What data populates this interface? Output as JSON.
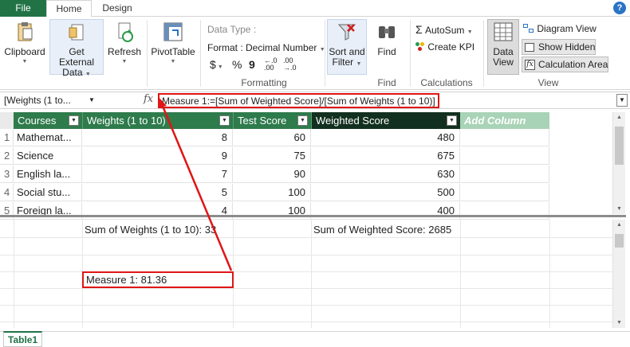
{
  "tabs": {
    "file": "File",
    "home": "Home",
    "design": "Design",
    "help": "?"
  },
  "ribbon": {
    "clipboard": "Clipboard",
    "get_external_data_line1": "Get External",
    "get_external_data_line2": "Data",
    "refresh": "Refresh",
    "pivottable": "PivotTable",
    "data_type": "Data Type :",
    "format": "Format : Decimal Number",
    "currency_symbol": "$",
    "percent_symbol": "%",
    "comma_symbol": "9",
    "formatting_group": "Formatting",
    "sort_filter_line1": "Sort and",
    "sort_filter_line2": "Filter",
    "find_button": "Find",
    "find_group": "Find",
    "autosum": "AutoSum",
    "create_kpi": "Create KPI",
    "calculations_group": "Calculations",
    "data_view_line1": "Data",
    "data_view_line2": "View",
    "diagram_view": "Diagram View",
    "show_hidden": "Show Hidden",
    "calculation_area": "Calculation Area",
    "view_group": "View"
  },
  "formula_bar": {
    "name_box": "[Weights (1 to...",
    "fx": "fx",
    "formula": "Measure 1:=[Sum of Weighted Score]/[Sum of Weights (1 to 10)]"
  },
  "table": {
    "headers": [
      "Courses",
      "Weights (1 to 10)",
      "Test Score",
      "Weighted Score",
      "Add Column"
    ],
    "rows": [
      {
        "n": "1",
        "course": "Mathemat...",
        "weight": "8",
        "score": "60",
        "weighted": "480"
      },
      {
        "n": "2",
        "course": "Science",
        "weight": "9",
        "score": "75",
        "weighted": "675"
      },
      {
        "n": "3",
        "course": "English la...",
        "weight": "7",
        "score": "90",
        "weighted": "630"
      },
      {
        "n": "4",
        "course": "Social stu...",
        "weight": "5",
        "score": "100",
        "weighted": "500"
      },
      {
        "n": "5",
        "course": "Foreign la...",
        "weight": "4",
        "score": "100",
        "weighted": "400"
      }
    ]
  },
  "calc_area": {
    "sum_weights": "Sum of Weights (1 to 10): 33",
    "sum_weighted": "Sum of Weighted Score: 2685",
    "measure1": "Measure 1: 81.36"
  },
  "sheet_tab": "Table1",
  "colors": {
    "accent_green": "#217346",
    "header_green": "#2e7b4c",
    "header_dark": "#12301f",
    "add_column": "#a9d3b6",
    "annotation_red": "#e01515"
  }
}
